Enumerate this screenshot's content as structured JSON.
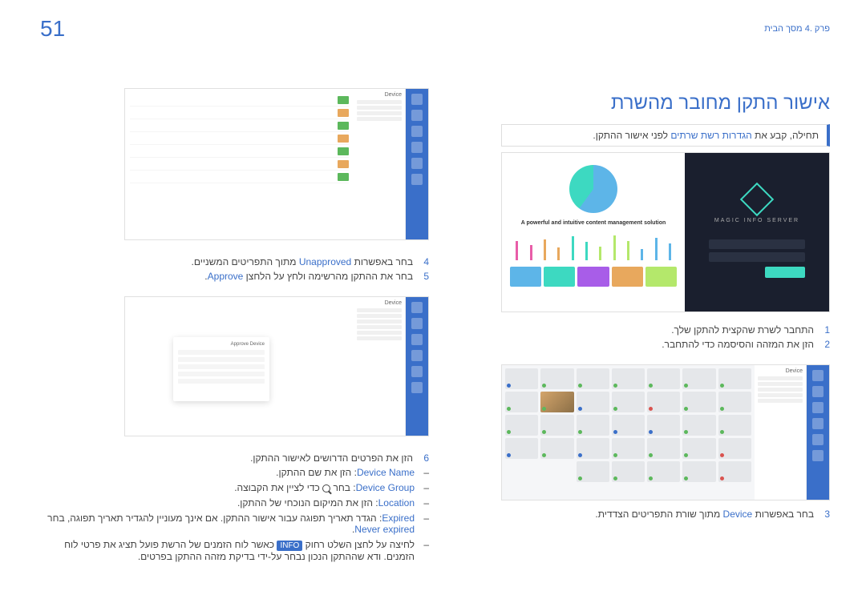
{
  "page_number": "51",
  "breadcrumb": "פרק .4 מסך הבית",
  "title": "אישור התקן מחובר מהשרת",
  "info_prefix": "תחילה, קבע את ",
  "info_highlight": "הגדרות רשת שרתים",
  "info_suffix": " לפני אישור ההתקן.",
  "login_tagline": "A powerful and intuitive content management solution",
  "logo_text": "MAGIC INFO SERVER",
  "step1_num": "1",
  "step1_text": "התחבר לשרת שהקצית להתקן שלך.",
  "step2_num": "2",
  "step2_text": "הזן את המזהה והסיסמה כדי להתחבר.",
  "panel_device": "Device",
  "step3_num": "3",
  "step3_text_before": "בחר באפשרות ",
  "step3_kw": "Device",
  "step3_text_after": " מתוך שורת התפריטים הצדדית.",
  "step4_num": "4",
  "step4_text_before": "בחר באפשרות ",
  "step4_kw": "Unapproved",
  "step4_text_after": " מתוך התפריטים המשניים.",
  "step5_num": "5",
  "step5_text_before": "בחר את ההתקן מהרשימה ולחץ על הלחצן ",
  "step5_kw": "Approve",
  "step5_text_after": ".",
  "popup_title": "Approve Device",
  "step6_num": "6",
  "step6_text": "הזן את הפרטים הדרושים לאישור ההתקן.",
  "b1_kw": "Device Name",
  "b1_text": ": הזן את שם ההתקן.",
  "b2_kw": "Device Group",
  "b2_text_before": ": בחר ",
  "b2_text_after": " כדי לציין את הקבוצה.",
  "b3_kw": "Location",
  "b3_text": ": הזן את המיקום הנוכחי של ההתקן.",
  "b4_kw": "Expired",
  "b4_text": ": הגדר תאריך תפוגה עבור אישור ההתקן. אם אינך מעוניין להגדיר תאריך תפוגה, בחר ",
  "b4_kw2": "Never expired",
  "b4_text2": ".",
  "b5_text_before": "לחיצה על לחצן השלט רחוק ",
  "b5_badge": "INFO",
  "b5_text_after": " כאשר לוח הזמנים של הרשת פועל תציג את פרטי לוח הזמנים. ודא שההתקן הנכון נבחר על-ידי בדיקת מזהה ההתקן בפרטים."
}
